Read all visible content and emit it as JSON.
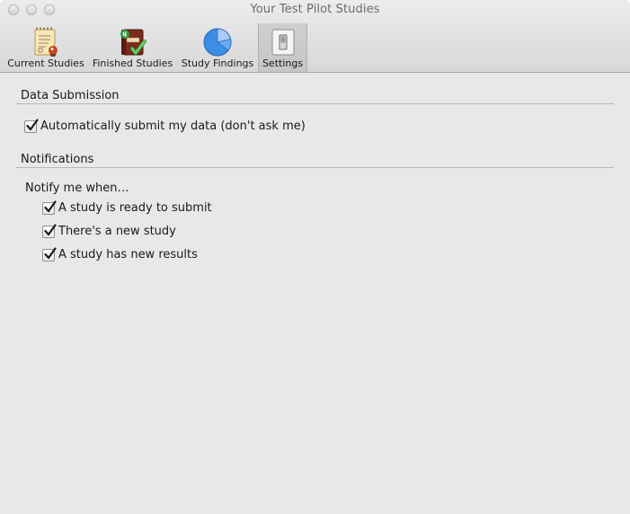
{
  "window": {
    "title": "Your Test Pilot Studies"
  },
  "toolbar": {
    "tabs": [
      {
        "label": "Current Studies",
        "icon": "notepad-icon"
      },
      {
        "label": "Finished Studies",
        "icon": "book-check-icon"
      },
      {
        "label": "Study Findings",
        "icon": "pie-chart-icon"
      },
      {
        "label": "Settings",
        "icon": "switch-icon",
        "selected": true
      }
    ]
  },
  "data_submission": {
    "heading": "Data Submission",
    "auto_submit_label": "Automatically submit my data (don't ask me)",
    "auto_submit_checked": true
  },
  "notifications": {
    "heading": "Notifications",
    "intro": "Notify me when…",
    "options": [
      {
        "label": "A study is ready to submit",
        "checked": true
      },
      {
        "label": "There's a new study",
        "checked": true
      },
      {
        "label": "A study has new results",
        "checked": true
      }
    ]
  },
  "colors": {
    "window_bg": "#e8e8e8",
    "pie_blue": "#3c8de6",
    "check_green": "#3aa63a"
  }
}
